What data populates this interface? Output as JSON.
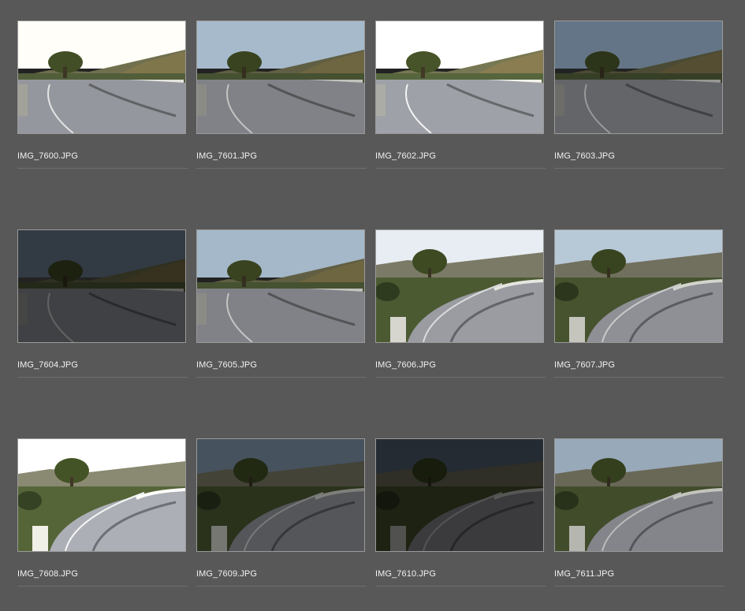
{
  "gallery": {
    "items": [
      {
        "filename": "IMG_7600.JPG",
        "scene": "A",
        "sky": "#f3f2ec",
        "brightness": 1.05
      },
      {
        "filename": "IMG_7601.JPG",
        "scene": "A",
        "sky": "#b9cfe3",
        "brightness": 0.9
      },
      {
        "filename": "IMG_7602.JPG",
        "scene": "A",
        "sky": "#f1f1ec",
        "brightness": 1.12
      },
      {
        "filename": "IMG_7603.JPG",
        "scene": "A",
        "sky": "#8ea7bf",
        "brightness": 0.7
      },
      {
        "filename": "IMG_7604.JPG",
        "scene": "A",
        "sky": "#6f8095",
        "brightness": 0.45
      },
      {
        "filename": "IMG_7605.JPG",
        "scene": "A",
        "sky": "#b6ccdf",
        "brightness": 0.9
      },
      {
        "filename": "IMG_7606.JPG",
        "scene": "B",
        "sky": "#e7edf2",
        "brightness": 1.0
      },
      {
        "filename": "IMG_7607.JPG",
        "scene": "B",
        "sky": "#c7d9ea",
        "brightness": 0.92
      },
      {
        "filename": "IMG_7608.JPG",
        "scene": "B",
        "sky": "#f3f3ee",
        "brightness": 1.12
      },
      {
        "filename": "IMG_7609.JPG",
        "scene": "B",
        "sky": "#7f95a9",
        "brightness": 0.55
      },
      {
        "filename": "IMG_7610.JPG",
        "scene": "B",
        "sky": "#5f7183",
        "brightness": 0.38
      },
      {
        "filename": "IMG_7611.JPG",
        "scene": "B",
        "sky": "#b3c7da",
        "brightness": 0.85
      }
    ]
  }
}
